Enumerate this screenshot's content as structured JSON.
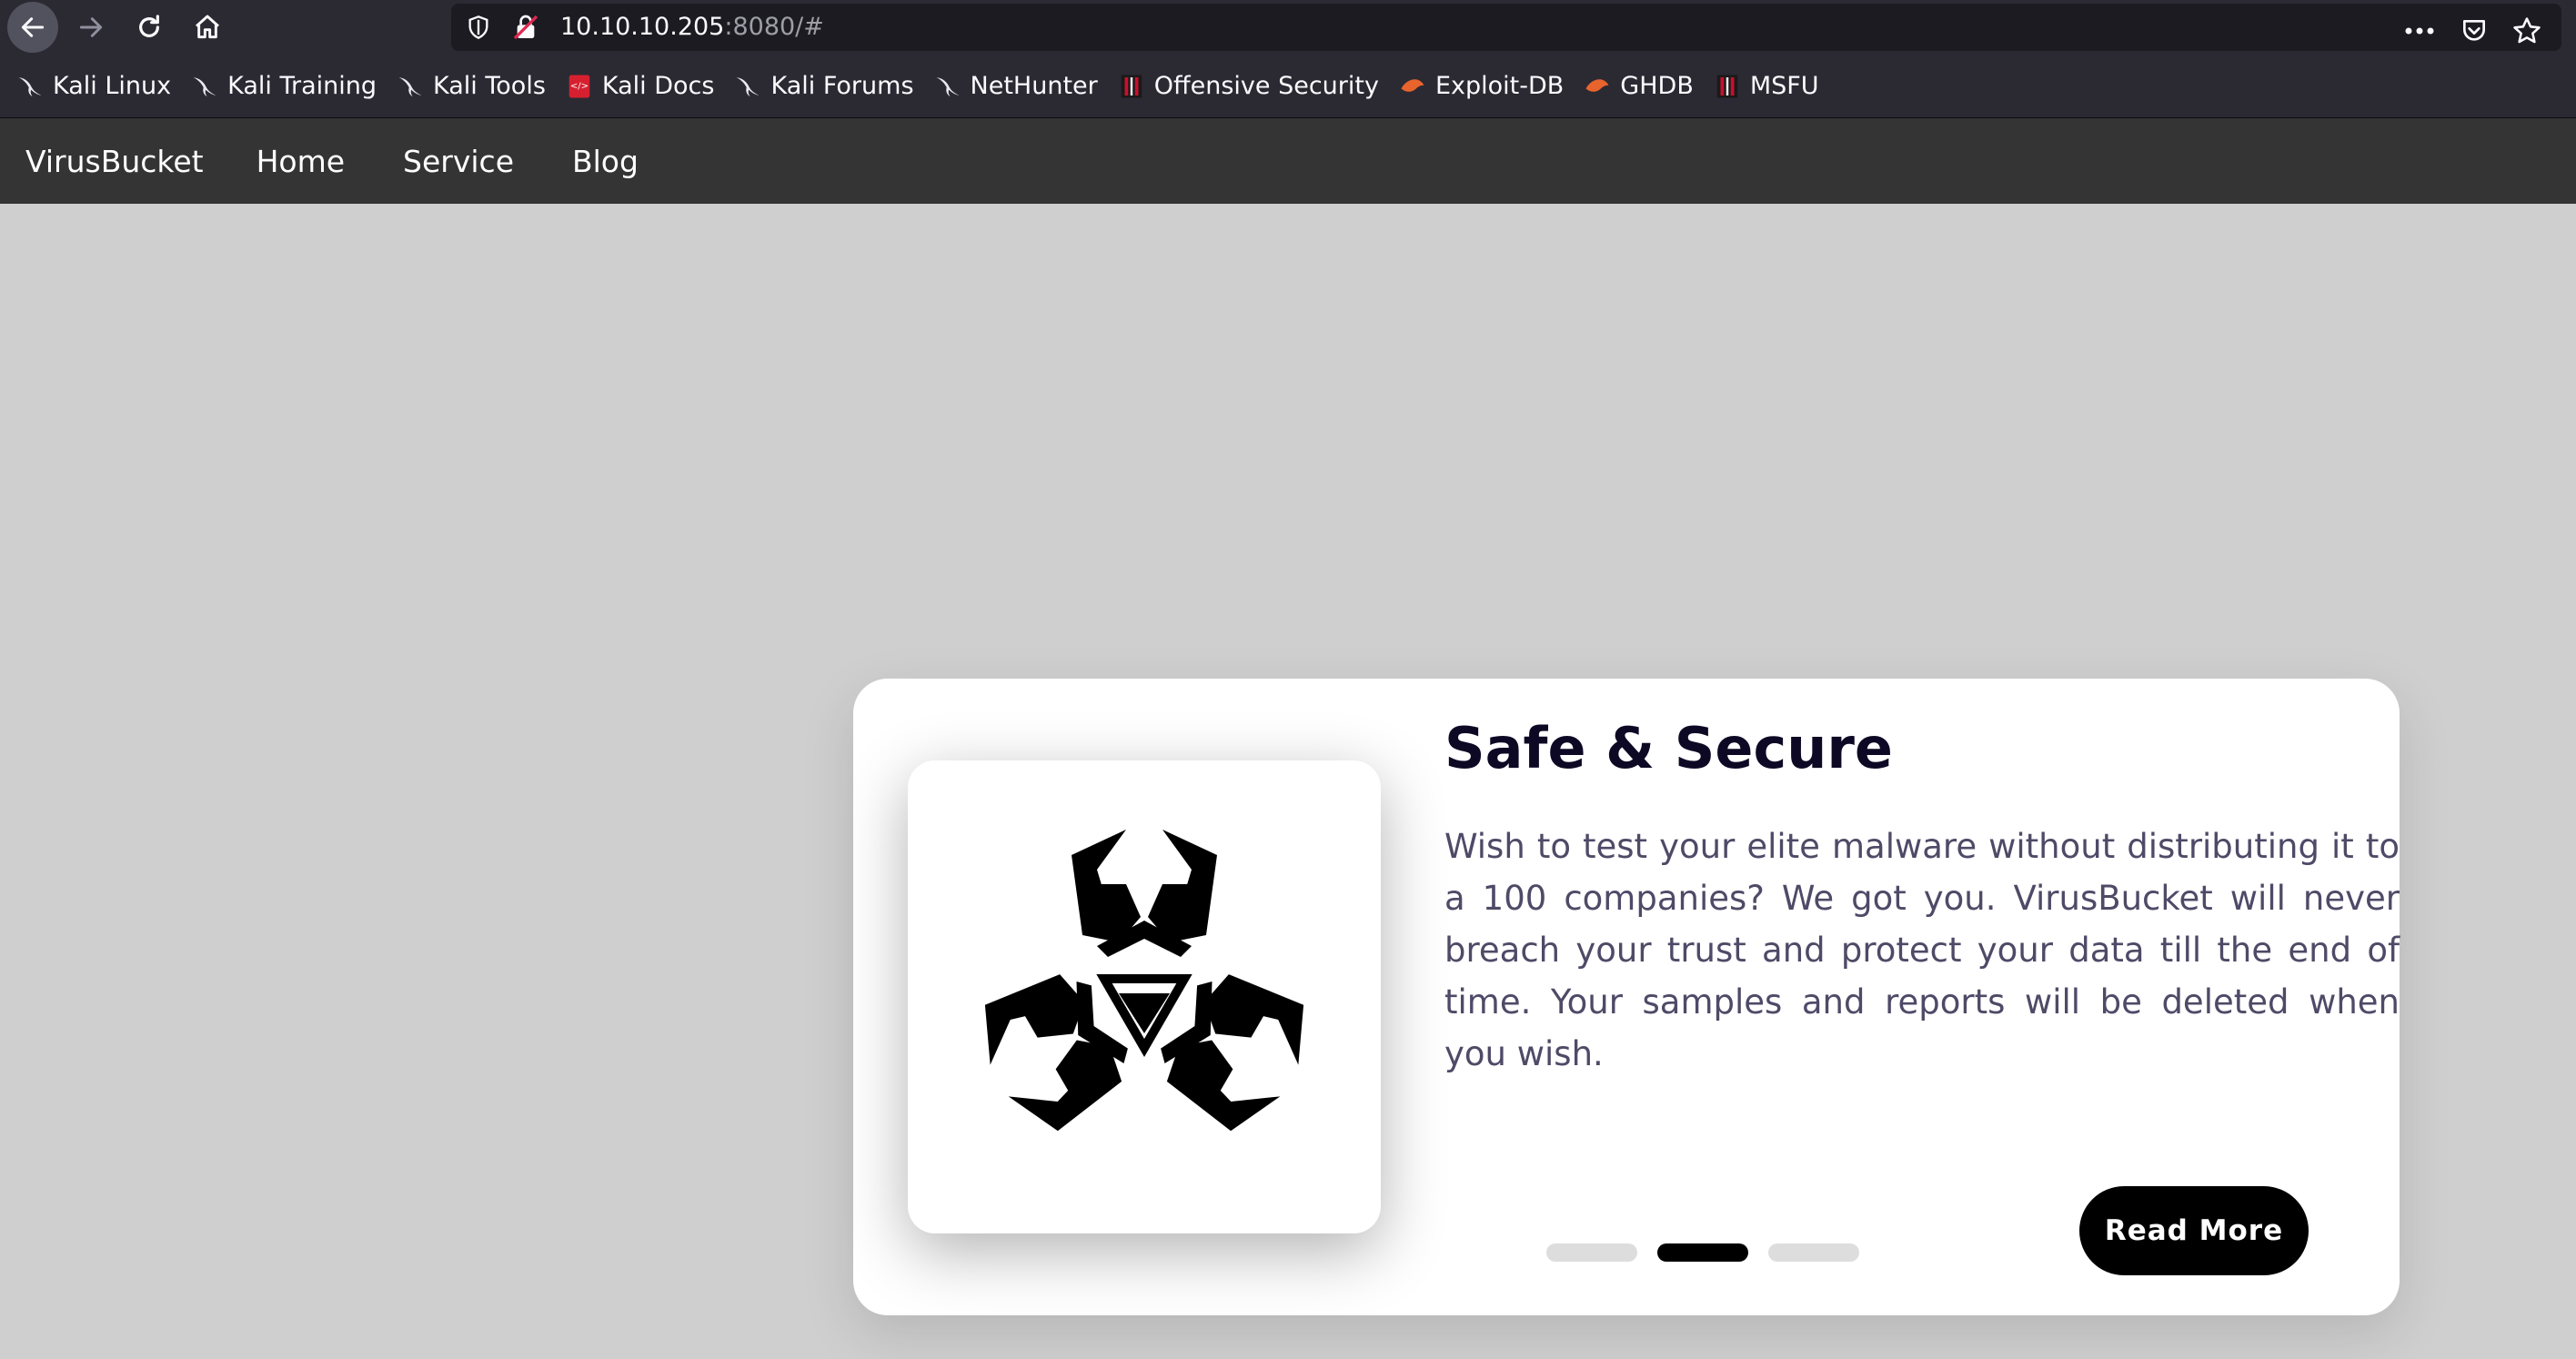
{
  "browser": {
    "url_host": "10.10.10.205",
    "url_rest": ":8080/#",
    "bookmarks": [
      {
        "label": "Kali Linux",
        "icon": "kali-dragon-icon"
      },
      {
        "label": "Kali Training",
        "icon": "kali-dragon-icon"
      },
      {
        "label": "Kali Tools",
        "icon": "kali-dragon-icon"
      },
      {
        "label": "Kali Docs",
        "icon": "kali-docs-icon"
      },
      {
        "label": "Kali Forums",
        "icon": "kali-dragon-icon"
      },
      {
        "label": "NetHunter",
        "icon": "kali-dragon-icon"
      },
      {
        "label": "Offensive Security",
        "icon": "offsec-icon"
      },
      {
        "label": "Exploit-DB",
        "icon": "exploitdb-icon"
      },
      {
        "label": "GHDB",
        "icon": "exploitdb-icon"
      },
      {
        "label": "MSFU",
        "icon": "offsec-icon"
      }
    ]
  },
  "site": {
    "brand": "VirusBucket",
    "nav": [
      "Home",
      "Service",
      "Blog"
    ]
  },
  "card": {
    "image_icon": "biohazard-icon",
    "title": "Safe & Secure",
    "text": "Wish to test your elite malware without distributing it to a 100 companies? We got you. VirusBucket will never breach your trust and protect your data till the end of time. Your samples and reports will be deleted when you wish.",
    "button": "Read More",
    "slides_total": 3,
    "slide_active": 2
  },
  "colors": {
    "page_bg": "#cfcfcf",
    "navbar_bg": "#343434",
    "title": "#0d0925",
    "text": "#4e4a67",
    "button_bg": "#000000"
  }
}
